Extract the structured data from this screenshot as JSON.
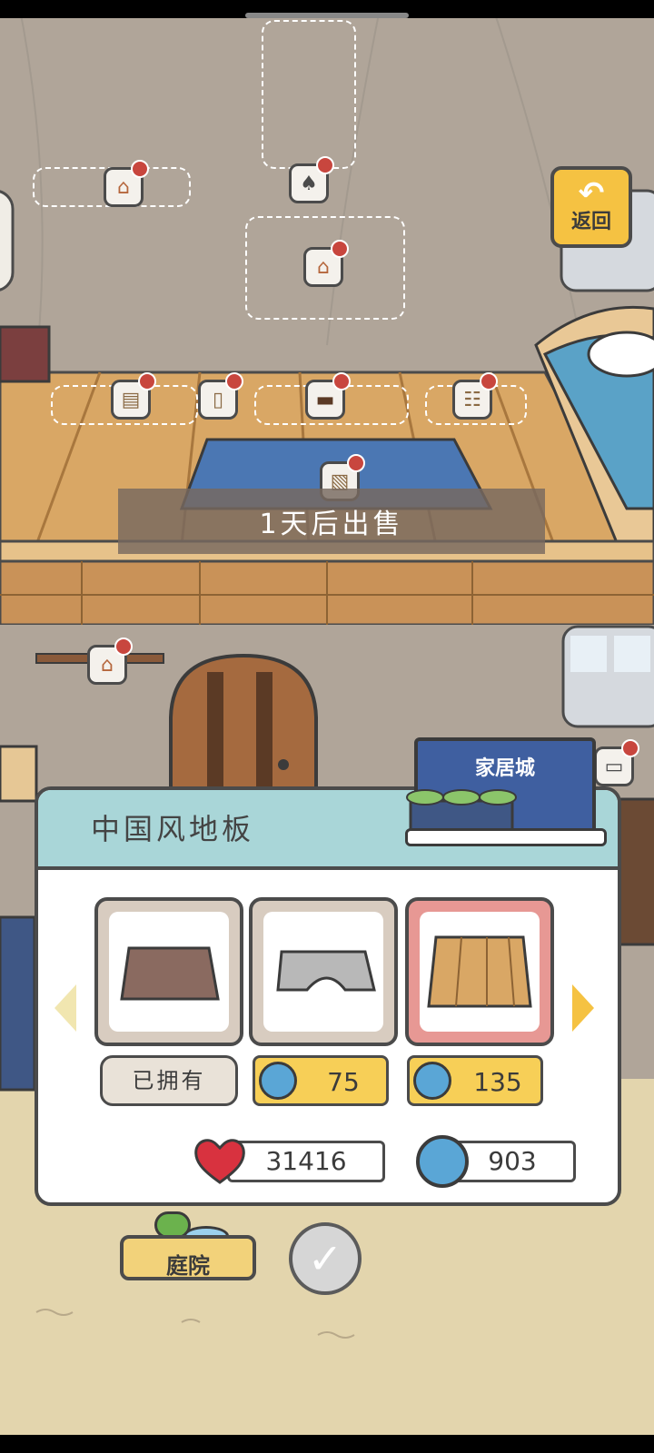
{
  "top_buttons": {
    "return_label": "返回"
  },
  "banner": {
    "text": "1天后出售"
  },
  "shop": {
    "title": "中国风地板",
    "store_name": "家居城",
    "items": [
      {
        "name": "dark-wood-floor",
        "status": "已拥有"
      },
      {
        "name": "gray-stone-floor",
        "price": "75"
      },
      {
        "name": "light-wood-floor",
        "price": "135"
      }
    ],
    "hearts": "31416",
    "coins": "903",
    "yard_label": "庭院"
  },
  "colors": {
    "accent_yellow": "#f5c242",
    "panel_header": "#a9d6d8",
    "selected_card": "#e79894",
    "coin_blue": "#5aa6d6",
    "heart_red": "#d8323f"
  }
}
